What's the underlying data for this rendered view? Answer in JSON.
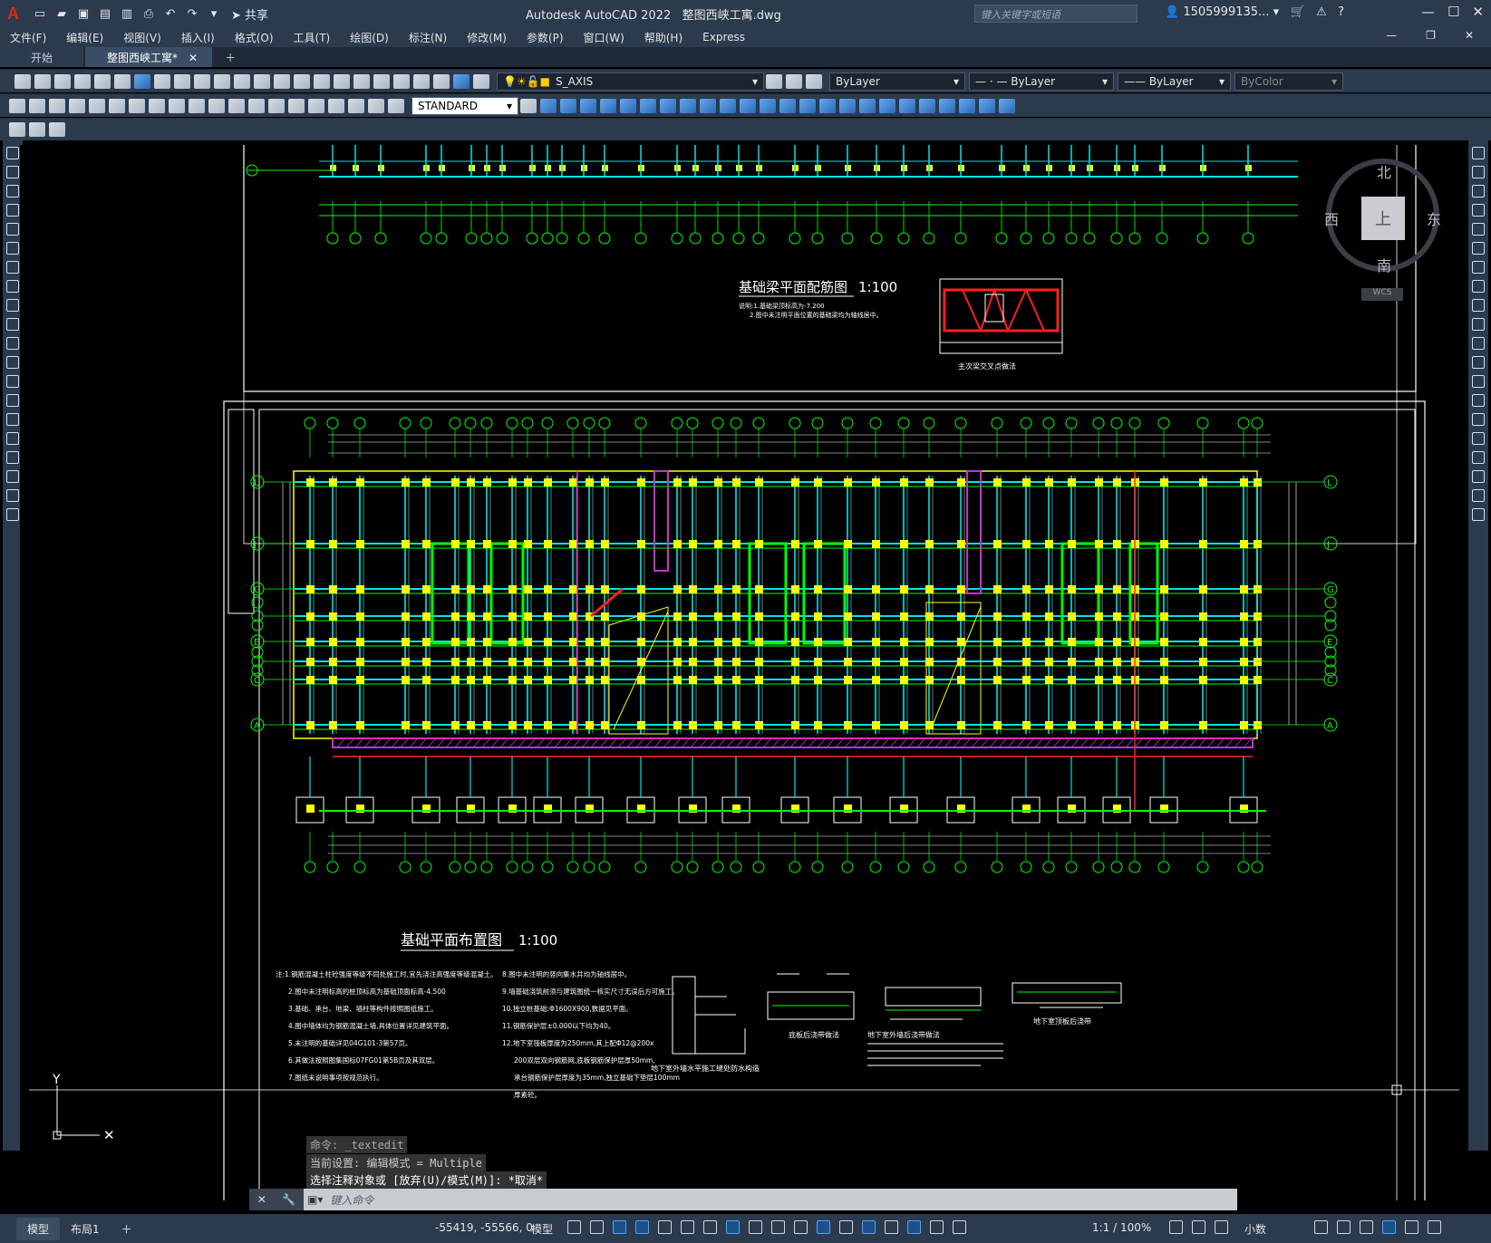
{
  "app": {
    "logo": "A",
    "title": "Autodesk AutoCAD 2022",
    "file": "整图西峡工寓.dwg",
    "search_placeholder": "键入关键字或短语",
    "user": "1505999135...",
    "share": "共享"
  },
  "menu": [
    "文件(F)",
    "编辑(E)",
    "视图(V)",
    "插入(I)",
    "格式(O)",
    "工具(T)",
    "绘图(D)",
    "标注(N)",
    "修改(M)",
    "参数(P)",
    "窗口(W)",
    "帮助(H)",
    "Express"
  ],
  "tabs": [
    {
      "label": "开始"
    },
    {
      "label": "整图西峡工寓*"
    }
  ],
  "layer": {
    "name": "S_AXIS"
  },
  "properties": {
    "color": "ByLayer",
    "linetype": "ByLayer",
    "lineweight": "ByLayer",
    "plotstyle": "ByColor"
  },
  "textstyle": "STANDARD",
  "viewcube": {
    "top": "上",
    "north": "北",
    "south": "南",
    "east": "东",
    "west": "西",
    "wcs": "WCS"
  },
  "drawing": {
    "upper_title": "基础梁平面配筋图",
    "upper_scale": "1:100",
    "upper_note1": "说明:1.基础梁顶标高为-7.200",
    "upper_note2": "2.图中未注明平面位置的基础梁均为轴线居中。",
    "section_caption": "主次梁交叉点做法",
    "lower_title": "基础平面布置图",
    "lower_scale": "1:100",
    "grid_labels": [
      "L",
      "J",
      "G",
      "E",
      "C",
      "A"
    ],
    "notes_left": [
      "注:1.钢筋混凝土柱砼强度等级不同处施工时,宜先浇注高强度等级混凝土。",
      "2.图中未注明标高的桩顶标高为基础顶面标高-4.500",
      "3.基础、承台、地梁、墙柱等构件按照图纸施工。",
      "4.图中墙体均为钢筋混凝土墙,具体位置详见建筑平面。",
      "5.未注明的基础详见04G101-3第57页。",
      "6.其做法按照图集国标07FG01第5B页及其双层。",
      "7.图纸未说明事项按规范执行。"
    ],
    "notes_right": [
      "8.图中未注明的竖向集水井均为轴线居中。",
      "9.墙基础浇筑前须与建筑图统一核实尺寸无误后方可施工。",
      "10.独立桩基础:Φ1600X900,数据见平面。",
      "11.钢筋保护层±0.000以下均为40。",
      "12.地下室筏板厚度为250mm,其上配Φ12@200x",
      "200双层双向钢筋网,底板钢筋保护层厚50mm,",
      "承台钢筋保护层厚度为35mm,独立基础下垫层100mm",
      "厚素砼。"
    ],
    "detail_captions": [
      "地下室外墙水平施工缝处防水构造",
      "底板后浇带做法",
      "地下室外墙后浇带做法",
      "地下室顶板后浇带"
    ]
  },
  "command": {
    "history": [
      "命令: _textedit",
      "当前设置: 编辑模式 = Multiple",
      "选择注释对象或 [放弃(U)/模式(M)]: *取消*"
    ],
    "placeholder": "键入命令"
  },
  "status": {
    "model_tab": "模型",
    "layout_tab": "布局1",
    "coords": "-55419, -55566, 0",
    "model": "模型",
    "scale": "1:1 / 100%",
    "units": "小数"
  },
  "colors": {
    "grid": "#00ff00",
    "beam": "#00e5e5",
    "column": "#ffff00",
    "hatch": "#c832c8",
    "red": "#ff2020"
  }
}
